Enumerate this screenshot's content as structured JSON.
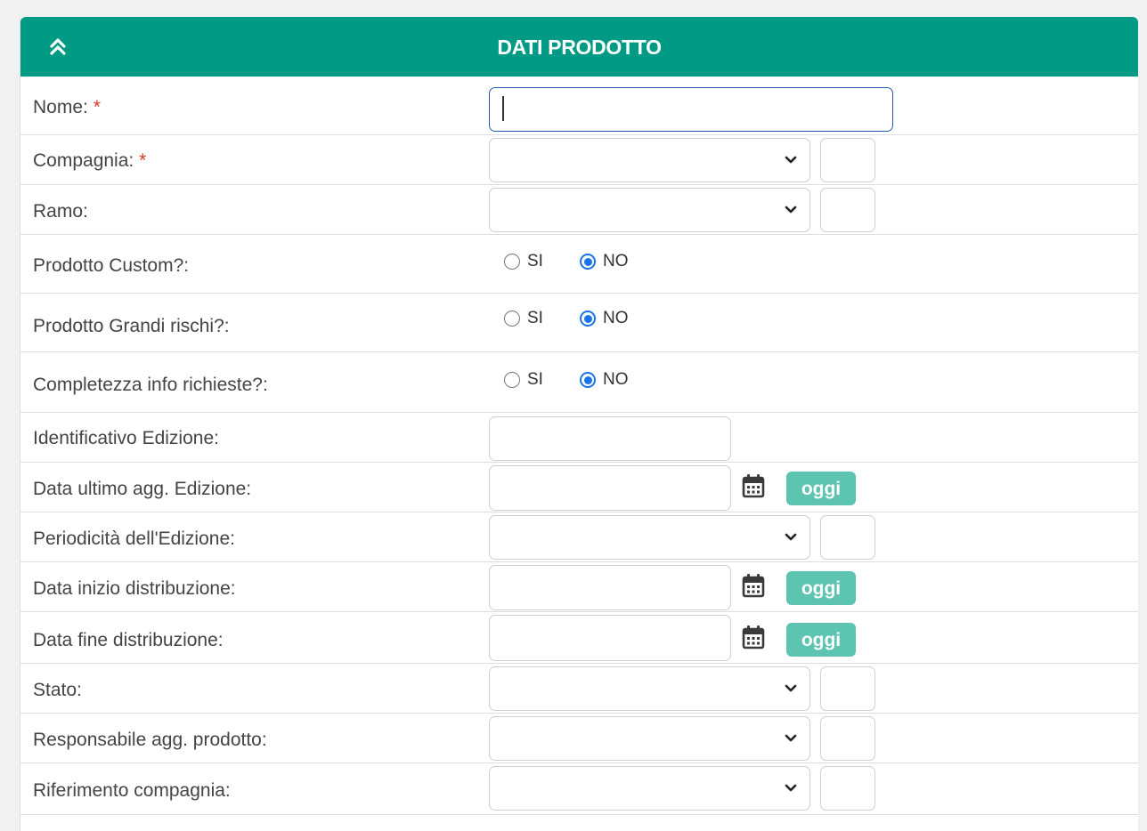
{
  "panel": {
    "title": "DATI PRODOTTO"
  },
  "fields": {
    "nome": {
      "label": "Nome:",
      "required": "*",
      "value": ""
    },
    "compagnia": {
      "label": "Compagnia:",
      "required": "*",
      "value": "",
      "code": ""
    },
    "ramo": {
      "label": "Ramo:",
      "value": "",
      "code": ""
    },
    "prodotto_custom": {
      "label": "Prodotto Custom?:",
      "opt_si": "SI",
      "opt_no": "NO",
      "selected": "NO"
    },
    "grandi_rischi": {
      "label": "Prodotto Grandi rischi?:",
      "opt_si": "SI",
      "opt_no": "NO",
      "selected": "NO"
    },
    "completezza_info": {
      "label": "Completezza info richieste?:",
      "opt_si": "SI",
      "opt_no": "NO",
      "selected": "NO"
    },
    "identificativo_edizione": {
      "label": "Identificativo Edizione:",
      "value": ""
    },
    "data_ultimo_agg": {
      "label": "Data ultimo agg. Edizione:",
      "value": "",
      "today_button": "oggi"
    },
    "periodicita_edizione": {
      "label": "Periodicità dell'Edizione:",
      "value": "",
      "code": ""
    },
    "data_inizio_distribuzione": {
      "label": "Data inizio distribuzione:",
      "value": "",
      "today_button": "oggi"
    },
    "data_fine_distribuzione": {
      "label": "Data fine distribuzione:",
      "value": "",
      "today_button": "oggi"
    },
    "stato": {
      "label": "Stato:",
      "value": "",
      "code": ""
    },
    "responsabile_agg": {
      "label": "Responsabile agg. prodotto:",
      "value": "",
      "code": ""
    },
    "riferimento_compagnia": {
      "label": "Riferimento compagnia:",
      "value": "",
      "code": ""
    }
  },
  "icons": {
    "collapse": "double-chevron-up-icon",
    "calendar": "calendar-icon",
    "dropdown": "chevron-down-icon"
  },
  "colors": {
    "header": "#009a85",
    "today_button": "#5ec4b2",
    "required_asterisk": "#d23a2a",
    "radio_selected": "#1a73e8"
  }
}
